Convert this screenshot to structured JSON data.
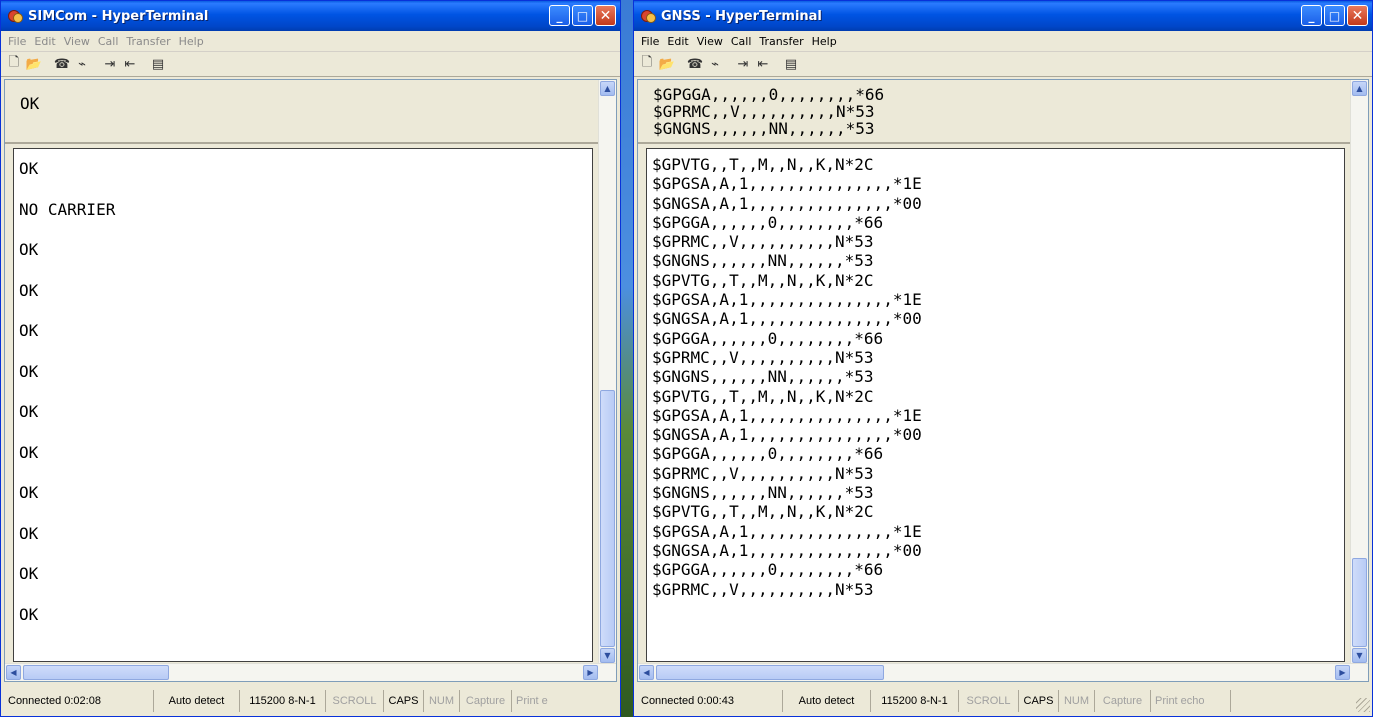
{
  "left_window": {
    "title": "SIMCom - HyperTerminal",
    "menu": [
      "File",
      "Edit",
      "View",
      "Call",
      "Transfer",
      "Help"
    ],
    "history_lines": [
      "OK"
    ],
    "terminal_lines": [
      "OK",
      "NO CARRIER",
      "OK",
      "OK",
      "OK",
      "OK",
      "OK",
      "OK",
      "OK",
      "OK",
      "OK",
      "OK"
    ],
    "status": {
      "connected": "Connected 0:02:08",
      "detect": "Auto detect",
      "settings": "115200 8-N-1",
      "scroll": "SCROLL",
      "caps": "CAPS",
      "num": "NUM",
      "capture": "Capture",
      "print_echo": "Print e"
    }
  },
  "right_window": {
    "title": "GNSS - HyperTerminal",
    "menu": [
      "File",
      "Edit",
      "View",
      "Call",
      "Transfer",
      "Help"
    ],
    "history_lines": [
      "$GPGGA,,,,,,0,,,,,,,,*66",
      "$GPRMC,,V,,,,,,,,,,N*53",
      "$GNGNS,,,,,,NN,,,,,,*53"
    ],
    "terminal_lines": [
      "$GPVTG,,T,,M,,N,,K,N*2C",
      "$GPGSA,A,1,,,,,,,,,,,,,,,*1E",
      "$GNGSA,A,1,,,,,,,,,,,,,,,*00",
      "$GPGGA,,,,,,0,,,,,,,,*66",
      "$GPRMC,,V,,,,,,,,,,N*53",
      "$GNGNS,,,,,,NN,,,,,,*53",
      "$GPVTG,,T,,M,,N,,K,N*2C",
      "$GPGSA,A,1,,,,,,,,,,,,,,,*1E",
      "$GNGSA,A,1,,,,,,,,,,,,,,,*00",
      "$GPGGA,,,,,,0,,,,,,,,*66",
      "$GPRMC,,V,,,,,,,,,,N*53",
      "$GNGNS,,,,,,NN,,,,,,*53",
      "$GPVTG,,T,,M,,N,,K,N*2C",
      "$GPGSA,A,1,,,,,,,,,,,,,,,*1E",
      "$GNGSA,A,1,,,,,,,,,,,,,,,*00",
      "$GPGGA,,,,,,0,,,,,,,,*66",
      "$GPRMC,,V,,,,,,,,,,N*53",
      "$GNGNS,,,,,,NN,,,,,,*53",
      "$GPVTG,,T,,M,,N,,K,N*2C",
      "$GPGSA,A,1,,,,,,,,,,,,,,,*1E",
      "$GNGSA,A,1,,,,,,,,,,,,,,,*00",
      "$GPGGA,,,,,,0,,,,,,,,*66",
      "$GPRMC,,V,,,,,,,,,,N*53"
    ],
    "status": {
      "connected": "Connected 0:00:43",
      "detect": "Auto detect",
      "settings": "115200 8-N-1",
      "scroll": "SCROLL",
      "caps": "CAPS",
      "num": "NUM",
      "capture": "Capture",
      "print_echo": "Print echo"
    }
  },
  "toolbar_icons": [
    "new-icon",
    "open-icon",
    "disconnect-icon",
    "dial-icon",
    "send-icon",
    "receive-icon",
    "properties-icon"
  ],
  "title_buttons": {
    "minimize": "_",
    "maximize": "□",
    "close": "✕"
  },
  "scroll_arrows": {
    "up": "▲",
    "down": "▼",
    "left": "◀",
    "right": "▶"
  },
  "colors": {
    "titlebar": "#0054e3",
    "window_bg": "#ece9d8",
    "terminal_bg": "#ffffff"
  }
}
